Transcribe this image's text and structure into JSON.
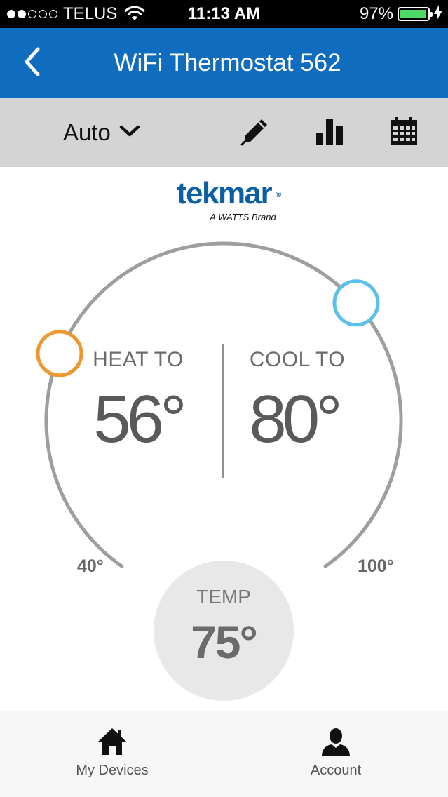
{
  "status_bar": {
    "carrier": "TELUS",
    "signal_dots_filled": 2,
    "signal_dots_total": 5,
    "time": "11:13 AM",
    "battery_percent": "97%",
    "battery_level": 0.97,
    "battery_color": "#4cd964"
  },
  "nav": {
    "title": "WiFi Thermostat 562",
    "back_icon": "chevron-left-icon",
    "background": "#0f6cbf"
  },
  "toolbar": {
    "mode": "Auto",
    "mode_icon": "chevron-down-icon",
    "edit_icon": "pencil-icon",
    "stats_icon": "bar-chart-icon",
    "schedule_icon": "calendar-icon"
  },
  "logo": {
    "brand": "tekmar",
    "registered": "®",
    "tagline": "A WATTS Brand"
  },
  "dial": {
    "min_label": "40°",
    "max_label": "100°",
    "min": 40,
    "max": 100,
    "heat_color": "#f0962e",
    "cool_color": "#5bc0eb",
    "track_color": "#9e9e9e"
  },
  "heat": {
    "label": "HEAT TO",
    "value": "56°",
    "setpoint": 56
  },
  "cool": {
    "label": "COOL TO",
    "value": "80°",
    "setpoint": 80
  },
  "current": {
    "label": "TEMP",
    "value": "75°"
  },
  "tabs": [
    {
      "label": "My Devices",
      "icon": "home-icon"
    },
    {
      "label": "Account",
      "icon": "user-icon"
    }
  ]
}
